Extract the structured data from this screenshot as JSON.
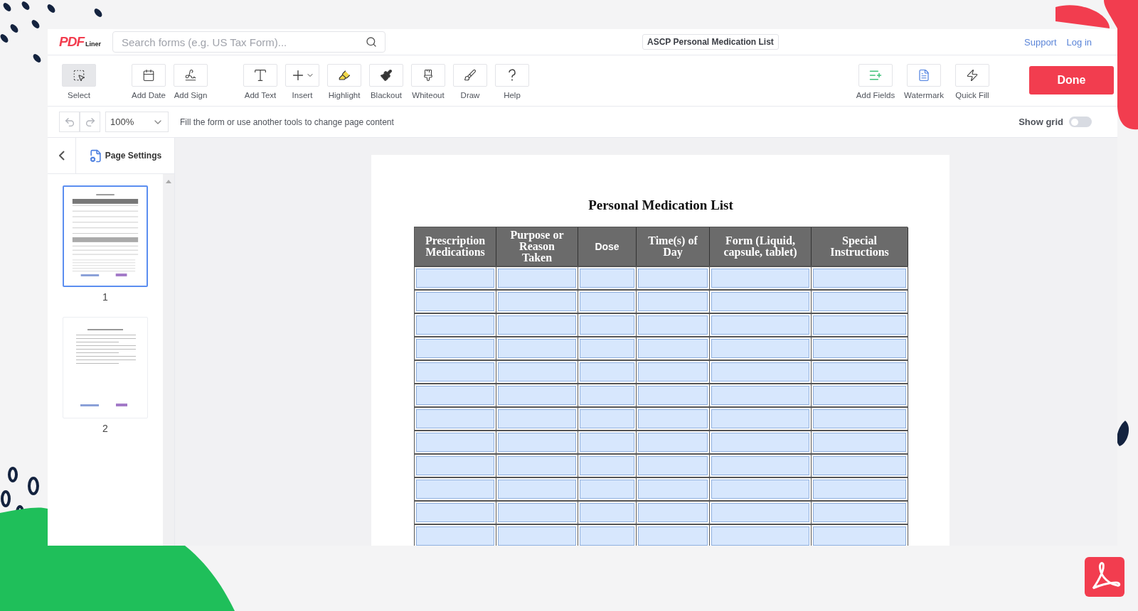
{
  "header": {
    "logo": {
      "main": "PDF",
      "sub": "Liner"
    },
    "search": {
      "placeholder": "Search forms (e.g. US Tax Form)..."
    },
    "document_title": "ASCP Personal Medication List",
    "links": [
      "Support",
      "Log in"
    ]
  },
  "toolbar": {
    "groups": [
      [
        {
          "label": "Select",
          "kind": "select",
          "selected": true
        }
      ],
      [
        {
          "label": "Add Date",
          "kind": "date",
          "selected": false
        },
        {
          "label": "Add Sign",
          "kind": "sign",
          "selected": false
        }
      ],
      [
        {
          "label": "Add Text",
          "kind": "text",
          "selected": false
        },
        {
          "label": "Insert",
          "kind": "insert",
          "selected": false
        },
        {
          "label": "Highlight",
          "kind": "highlight",
          "selected": false
        },
        {
          "label": "Blackout",
          "kind": "blackout",
          "selected": false
        },
        {
          "label": "Whiteout",
          "kind": "whiteout",
          "selected": false
        },
        {
          "label": "Draw",
          "kind": "draw",
          "selected": false
        },
        {
          "label": "Help",
          "kind": "help",
          "selected": false
        }
      ]
    ],
    "right_tools": [
      {
        "label": "Add Fields",
        "kind": "fields",
        "selected": false
      },
      {
        "label": "Watermark",
        "kind": "watermark",
        "selected": false
      },
      {
        "label": "Quick Fill",
        "kind": "quickfill",
        "selected": false
      }
    ],
    "done_button": "Done"
  },
  "subbar": {
    "zoom": "100%",
    "hint": "Fill the form or use another tools to change page content",
    "show_grid": {
      "label": "Show grid",
      "on": false
    }
  },
  "sidebar": {
    "page_settings": "Page Settings",
    "pages": [
      {
        "label": "1",
        "selected": true
      },
      {
        "label": "2",
        "selected": false
      }
    ]
  },
  "document": {
    "title": "Personal Medication List",
    "columns": [
      {
        "label": "Prescription Medications",
        "kind": "serif"
      },
      {
        "label": "Purpose or Reason Taken",
        "kind": "serif"
      },
      {
        "label": "Dose",
        "kind": "sans"
      },
      {
        "label": "Time(s) of Day",
        "kind": "serif"
      },
      {
        "label": "Form (Liquid, capsule, tablet)",
        "kind": "serif"
      },
      {
        "label": "Special Instructions",
        "kind": "serif"
      }
    ],
    "rows": [
      {
        "fillable": true
      },
      {
        "fillable": true
      },
      {
        "fillable": true
      },
      {
        "fillable": true
      },
      {
        "fillable": true
      },
      {
        "fillable": true
      },
      {
        "fillable": true
      },
      {
        "fillable": true
      },
      {
        "fillable": true
      },
      {
        "fillable": true
      },
      {
        "fillable": true
      },
      {
        "fillable": true
      }
    ]
  }
}
